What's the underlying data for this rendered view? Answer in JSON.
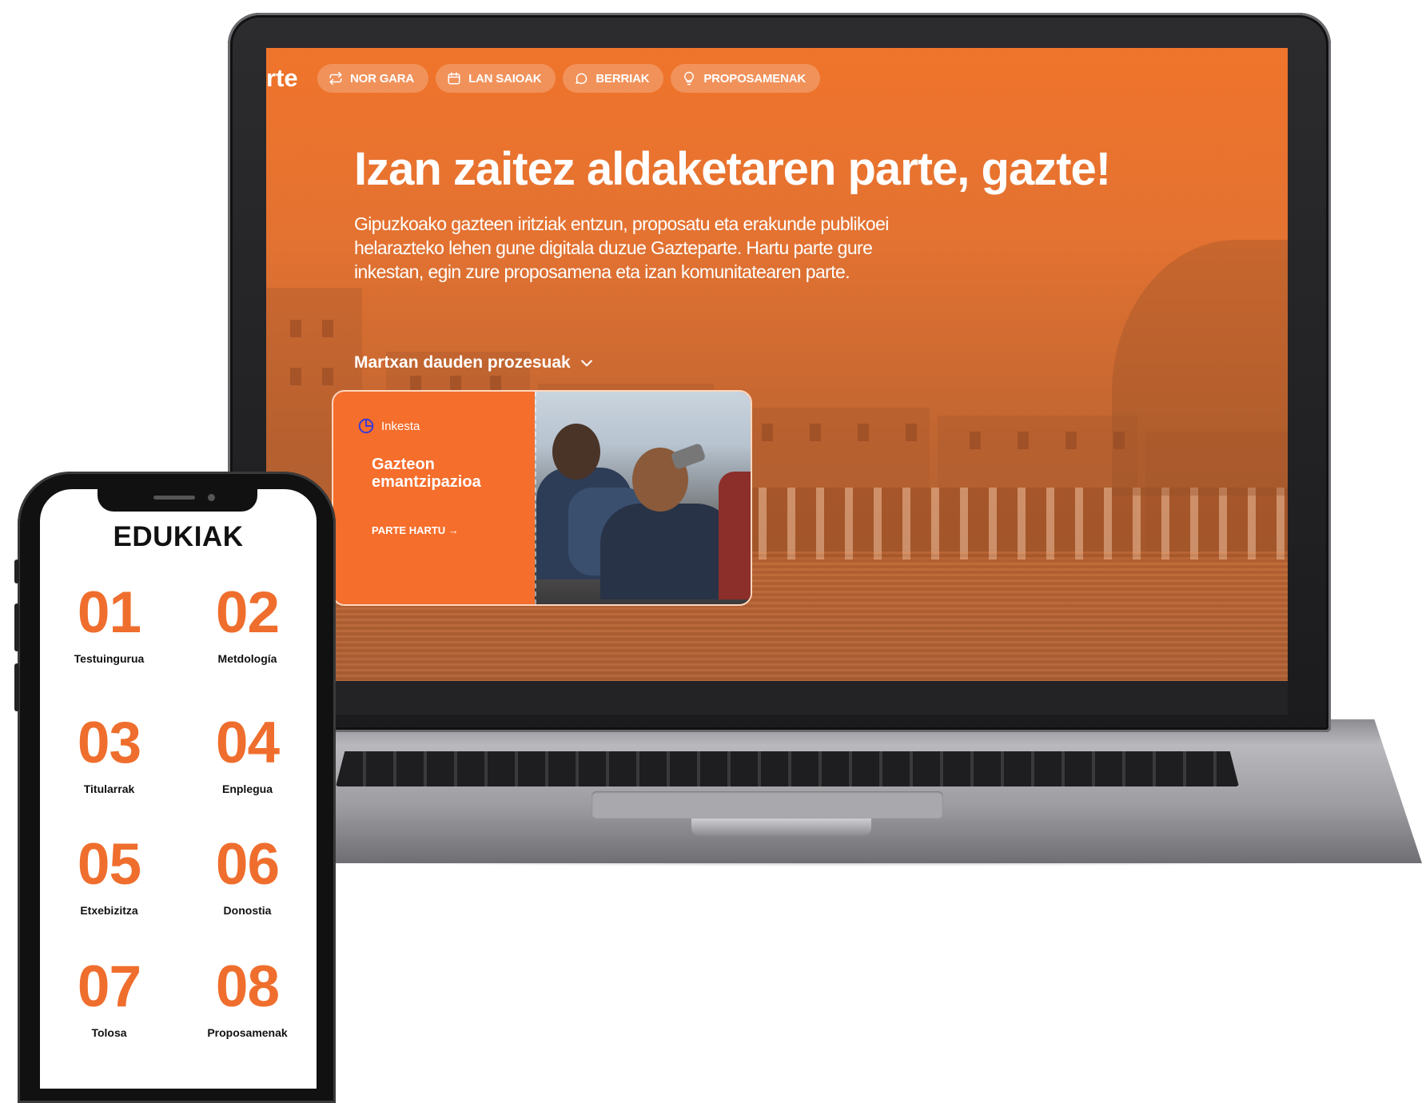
{
  "laptop": {
    "brand_fragment": "rte",
    "nav": [
      {
        "label": "NOR GARA",
        "icon": "repeat-icon"
      },
      {
        "label": "LAN SAIOAK",
        "icon": "calendar-icon"
      },
      {
        "label": "BERRIAK",
        "icon": "chat-icon"
      },
      {
        "label": "PROPOSAMENAK",
        "icon": "lightbulb-icon"
      }
    ],
    "hero": {
      "title": "Izan zaitez aldaketaren parte, gazte!",
      "text": "Gipuzkoako gazteen iritziak entzun, proposatu eta erakunde publikoei helarazteko lehen gune digitala duzue Gazteparte. Hartu parte gure inkestan, egin zure proposamena eta izan komunitatearen parte."
    },
    "processes_label": "Martxan dauden prozesuak",
    "card": {
      "type": "Inkesta",
      "type_icon": "pie-chart-icon",
      "title": "Gazteon emantzipazioa",
      "link": "PARTE HARTU →"
    }
  },
  "phone": {
    "title": "EDUKIAK",
    "items": [
      {
        "number": "01",
        "label": "Testuingurua"
      },
      {
        "number": "02",
        "label": "Metdología"
      },
      {
        "number": "03",
        "label": "Titularrak"
      },
      {
        "number": "04",
        "label": "Enplegua"
      },
      {
        "number": "05",
        "label": "Etxebizitza"
      },
      {
        "number": "06",
        "label": "Donostia"
      },
      {
        "number": "07",
        "label": "Tolosa"
      },
      {
        "number": "08",
        "label": "Proposamenak"
      }
    ]
  },
  "colors": {
    "brand_orange": "#f56e2c",
    "number_orange": "#ef6e2d",
    "text_dark": "#111111"
  }
}
